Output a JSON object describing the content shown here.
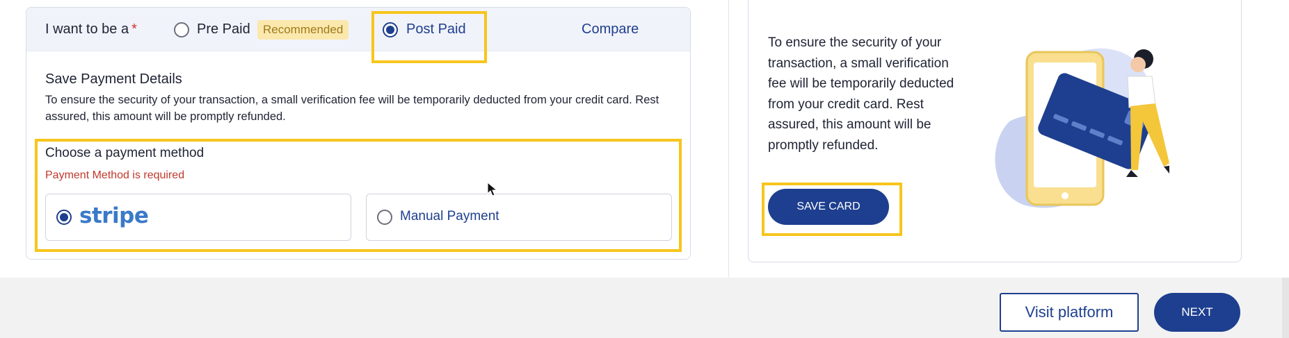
{
  "plan": {
    "label": "I want to be a",
    "required_mark": "*",
    "options": [
      {
        "label": "Pre Paid",
        "badge": "Recommended",
        "selected": false
      },
      {
        "label": "Post Paid",
        "selected": true
      }
    ],
    "compare_label": "Compare"
  },
  "payment_details": {
    "title": "Save Payment Details",
    "description": "To ensure the security of your transaction, a small verification fee will be temporarily deducted from your credit card. Rest assured, this amount will be promptly refunded."
  },
  "payment_method": {
    "title": "Choose a payment method",
    "error": "Payment Method is required",
    "options": [
      {
        "label": "stripe",
        "selected": true
      },
      {
        "label": "Manual Payment",
        "selected": false
      }
    ]
  },
  "side_panel": {
    "text": "To ensure the security of your transaction, a small verification fee will be temporarily deducted from your credit card. Rest assured, this amount will be promptly refunded.",
    "save_card_label": "SAVE CARD"
  },
  "footer": {
    "visit_label": "Visit platform",
    "next_label": "NEXT"
  },
  "colors": {
    "primary": "#1e3f8f",
    "highlight": "#f7c51c",
    "badge_bg": "#fbe8ad",
    "error": "#c0392b"
  }
}
